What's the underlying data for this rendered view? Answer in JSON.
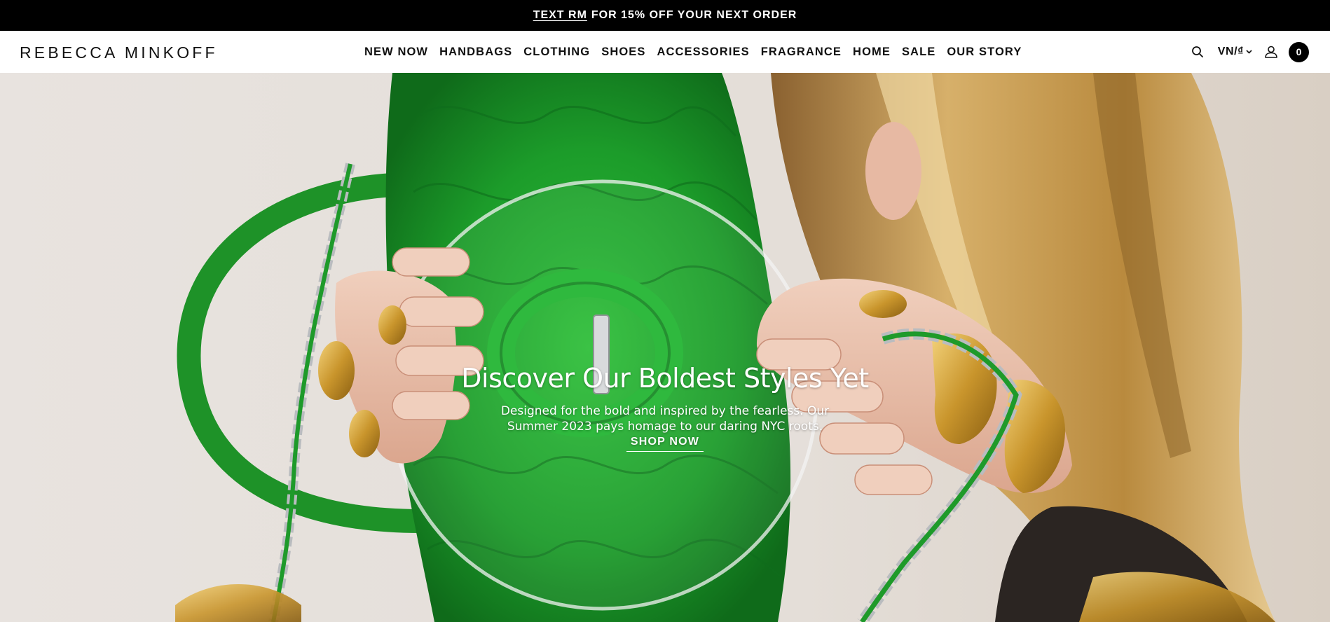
{
  "promo": {
    "link_text": "TEXT RM",
    "text": "FOR 15% OFF YOUR NEXT ORDER"
  },
  "header": {
    "logo": "REBECCA MINKOFF",
    "nav": [
      "NEW NOW",
      "HANDBAGS",
      "CLOTHING",
      "SHOES",
      "ACCESSORIES",
      "FRAGRANCE",
      "HOME",
      "SALE",
      "OUR STORY"
    ],
    "locale": "VN/₫",
    "cart_count": "0",
    "icons": {
      "search": "search-icon",
      "account": "user-icon",
      "locale_chevron": "chevron-down-icon"
    }
  },
  "hero": {
    "title": "Discover Our Boldest Styles Yet",
    "subtitle": "Designed for the bold and inspired by the fearless. Our Summer 2023 pays homage to our daring NYC roots.",
    "cta": "SHOP NOW",
    "colors": {
      "bag": "#1f9a2a",
      "background": "#e6e0db",
      "hair": "#c9a052",
      "gold": "#c9952c"
    }
  }
}
